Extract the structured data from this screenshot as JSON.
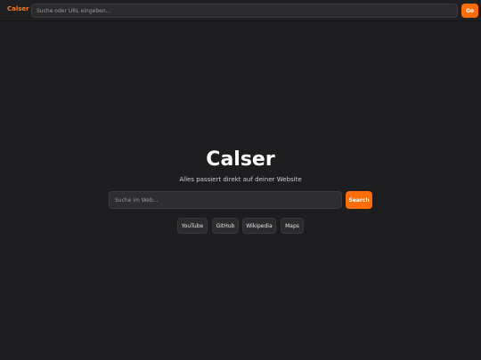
{
  "topbar": {
    "brand": "Calser",
    "url_placeholder": "Suche oder URL eingeben...",
    "go_label": "Go"
  },
  "main": {
    "title": "Calser",
    "subtitle": "Alles passiert direkt auf deiner Website",
    "search_placeholder": "Suche im Web...",
    "search_button": "Search",
    "quick_links": [
      {
        "label": "YouTube"
      },
      {
        "label": "GitHub"
      },
      {
        "label": "Wikipedia"
      },
      {
        "label": "Maps"
      }
    ]
  },
  "colors": {
    "accent": "#ff6d0a",
    "background": "#1e1e20"
  }
}
